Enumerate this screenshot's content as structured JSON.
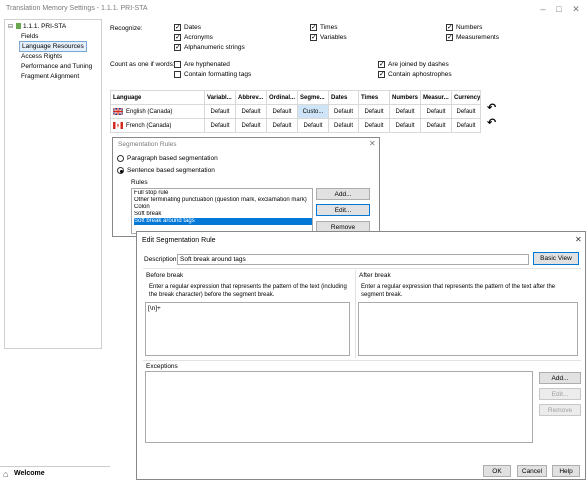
{
  "window": {
    "title": "Translation Memory Settings - 1.1.1. PRI-STA"
  },
  "tree": {
    "root": "1.1.1. PRI-STA",
    "items": [
      "Fields",
      "Language Resources",
      "Access Rights",
      "Performance and Tuning",
      "Fragment Alignment"
    ],
    "selected": "Language Resources"
  },
  "recognize": {
    "label": "Recognize:",
    "options": [
      {
        "label": "Dates",
        "checked": true
      },
      {
        "label": "Acronyms",
        "checked": true
      },
      {
        "label": "Alphanumeric strings",
        "checked": true
      },
      {
        "label": "Times",
        "checked": true
      },
      {
        "label": "Variables",
        "checked": true
      },
      {
        "label": "Numbers",
        "checked": true
      },
      {
        "label": "Measurements",
        "checked": true
      }
    ]
  },
  "count_words": {
    "label": "Count as one if words:",
    "options": [
      {
        "label": "Are hyphenated",
        "checked": false
      },
      {
        "label": "Contain formatting tags",
        "checked": false
      },
      {
        "label": "Are joined by dashes",
        "checked": true
      },
      {
        "label": "Contain aphostrophes",
        "checked": true
      }
    ]
  },
  "grid": {
    "headers": [
      "Language",
      "Variabl...",
      "Abbrev...",
      "Ordinal...",
      "Segme...",
      "Dates",
      "Times",
      "Numbers",
      "Measur...",
      "Currency"
    ],
    "rows": [
      {
        "language": "English (Canada)",
        "cells": [
          "Default",
          "Default",
          "Default",
          "Custo...",
          "Default",
          "Default",
          "Default",
          "Default",
          "Default"
        ]
      },
      {
        "language": "French (Canada)",
        "cells": [
          "Default",
          "Default",
          "Default",
          "Default",
          "Default",
          "Default",
          "Default",
          "Default",
          "Default"
        ]
      }
    ],
    "flag_colors": {
      "canada_red": "#d52b1e",
      "uk_blue": "#1f3f8f"
    }
  },
  "seg_rules": {
    "title": "Segmentation Rules",
    "paragraph_label": "Paragraph based segmentation",
    "sentence_label": "Sentence based segmentation",
    "mode": "sentence",
    "rules_label": "Rules",
    "rules": [
      "Full stop rule",
      "Other terminating punctuation (question mark, exclamation mark)",
      "Colon",
      "Soft break",
      "Soft break around tags"
    ],
    "selected_rule": "Soft break around tags",
    "add_label": "Add...",
    "edit_label": "Edit...",
    "remove_label": "Remove"
  },
  "edit_rule": {
    "title": "Edit Segmentation Rule",
    "close_glyph": "✕",
    "description_label": "Description",
    "description_value": "Soft break around tags",
    "basic_view_label": "Basic View",
    "before_label": "Before break",
    "before_hint": "Enter a regular expression that represents the pattern of the text (including the break character) before the segment break.",
    "before_value": "[\\n]+",
    "after_label": "After break",
    "after_hint": "Enter a regular expression that represents the pattern of the text after the segment break.",
    "after_value": "",
    "exceptions_label": "Exceptions",
    "ex_add": "Add...",
    "ex_edit": "Edit...",
    "ex_remove": "Remove",
    "ok": "OK",
    "cancel": "Cancel",
    "help": "Help"
  },
  "bottom": {
    "welcome": "Welcome"
  },
  "colors": {
    "accent": "#0078d7",
    "selection_bg": "#cfe5f7"
  }
}
